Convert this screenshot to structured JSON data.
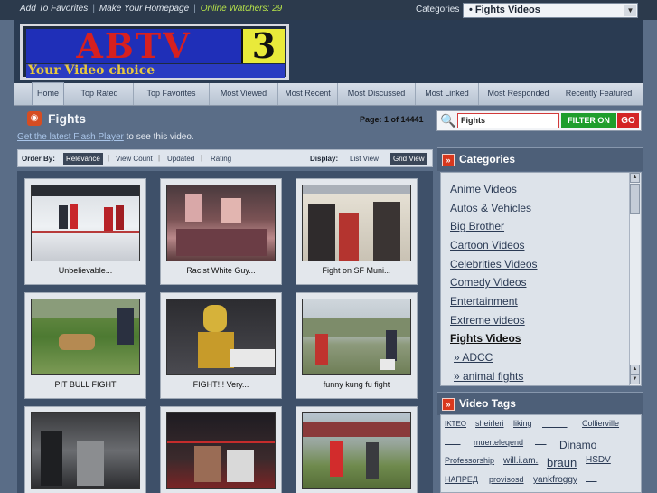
{
  "topbar": {
    "add_favorites": "Add To Favorites",
    "make_homepage": "Make Your Homepage",
    "watchers": "Online Watchers: 29",
    "categories_label": "Categories",
    "categories_selected": "• Fights Videos"
  },
  "logo": {
    "main": "ABTV",
    "number": "3",
    "tagline": "Your Video choice"
  },
  "nav": [
    "Home",
    "Top Rated",
    "Top Favorites",
    "Most Viewed",
    "Most Recent",
    "Most Discussed",
    "Most Linked",
    "Most Responded",
    "Recently Featured"
  ],
  "section": {
    "title": "Fights",
    "page_info": "Page: 1 of 14441"
  },
  "search": {
    "value": "Fights",
    "filter_label": "FILTER ON",
    "go_label": "GO"
  },
  "flash": {
    "link": "Get the latest Flash Player",
    "rest": " to see this video."
  },
  "orderbar": {
    "order_label": "Order By:",
    "options": [
      "Relevance",
      "View Count",
      "Updated",
      "Rating"
    ],
    "display_label": "Display:",
    "display_options": [
      "List View",
      "Grid View"
    ]
  },
  "videos": [
    {
      "caption": "Unbelievable..."
    },
    {
      "caption": "Racist White Guy..."
    },
    {
      "caption": "Fight on SF Muni..."
    },
    {
      "caption": "PIT BULL FIGHT"
    },
    {
      "caption": "FIGHT!!! Very..."
    },
    {
      "caption": "funny kung fu fight"
    },
    {
      "caption": ""
    },
    {
      "caption": ""
    },
    {
      "caption": ""
    }
  ],
  "categories_panel": {
    "title": "Categories",
    "items": [
      "Anime Videos",
      "Autos & Vehicles",
      "Big Brother",
      "Cartoon Videos",
      "Celebrities Videos",
      "Comedy Videos",
      "Entertainment",
      "Extreme videos",
      "Fights Videos",
      "» ADCC",
      "» animal fights"
    ]
  },
  "tags_panel": {
    "title": "Video Tags",
    "tags": [
      "IKTEO",
      "sheirleri",
      "liking",
      "Collierville",
      "muerteleqend",
      "Dinamo",
      "Professorship",
      "will.i.am.",
      "braun",
      "HSDV",
      "НАПРЕД",
      "provisosd",
      "yankfroggy"
    ]
  }
}
